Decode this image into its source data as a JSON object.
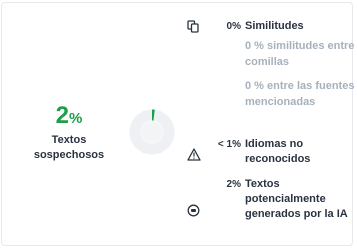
{
  "summary": {
    "value": "2",
    "unit": "%",
    "label": "Textos sospechosos",
    "fraction": 0.02,
    "accent_color": "#1e9e48"
  },
  "breakdown": {
    "similarities": {
      "icon": "copy-icon",
      "percent": "0%",
      "label": "Similitudes"
    },
    "quoted": {
      "text": "0 % similitudes entre comillas"
    },
    "cited_sources": {
      "text": "0 % entre las fuentes mencionadas"
    },
    "unrecognized_languages": {
      "icon": "warning-icon",
      "percent": "< 1%",
      "label": "Idiomas no reconocidos"
    },
    "ai_generated": {
      "icon": "robot-icon",
      "percent": "2%",
      "label": "Textos potencialmente generados por la IA"
    }
  }
}
